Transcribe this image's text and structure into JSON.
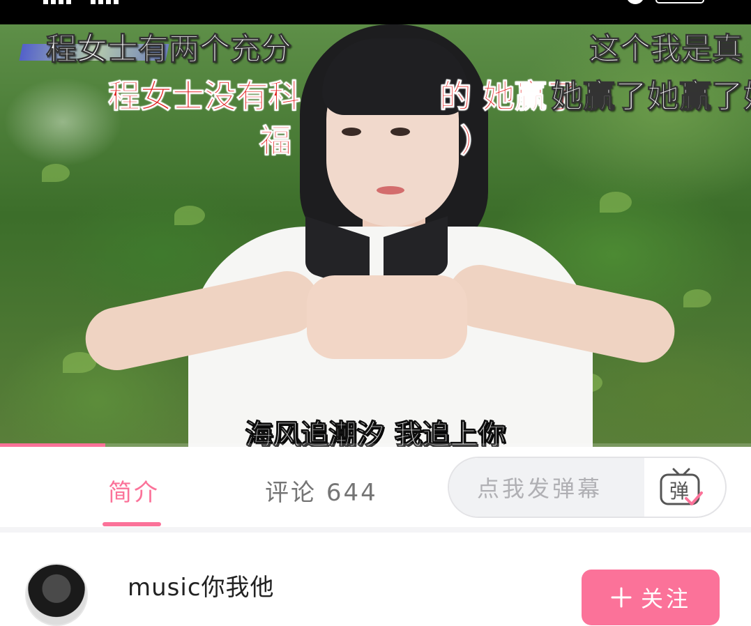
{
  "video": {
    "danmaku": [
      "程女士有两个充分",
      "这个我是真",
      "程女士没有科",
      "的 她赢了",
      "她赢了她赢了她",
      "福",
      "）"
    ],
    "subtitle": "海风追潮汐 我追上你",
    "progress_fraction": 0.14
  },
  "tabs": [
    {
      "label": "简介",
      "active": true
    },
    {
      "label": "评论",
      "count": "644",
      "active": false
    }
  ],
  "danmaku_input": {
    "placeholder": "点我发弹幕",
    "toggle_icon": "danmaku-toggle-icon",
    "toggle_glyph": "弹"
  },
  "author": {
    "name": "music你我他",
    "follow_label": "关注",
    "follow_icon": "plus-icon"
  },
  "colors": {
    "accent": "#fb7299",
    "tab_inactive": "#757575",
    "placeholder": "#b0b0b4"
  }
}
